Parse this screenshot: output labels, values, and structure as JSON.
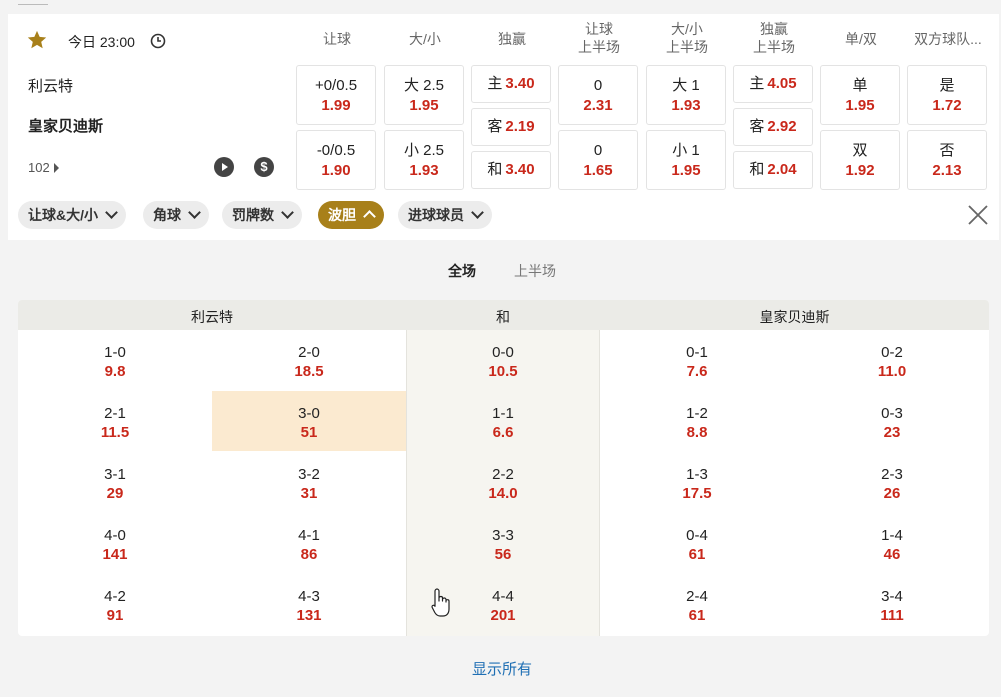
{
  "match": {
    "time": "今日 23:00",
    "home": "利云特",
    "away": "皇家贝迪斯",
    "more_count": "102",
    "dollar_symbol": "$",
    "icons": [
      "star-icon",
      "clock-icon",
      "play-icon",
      "dollar-icon",
      "close-icon"
    ]
  },
  "columns": [
    {
      "label": "让球",
      "label2": ""
    },
    {
      "label": "大/小",
      "label2": ""
    },
    {
      "label": "独赢",
      "label2": ""
    },
    {
      "label": "让球",
      "label2": "上半场"
    },
    {
      "label": "大/小",
      "label2": "上半场"
    },
    {
      "label": "独赢",
      "label2": "上半场"
    },
    {
      "label": "单/双",
      "label2": ""
    },
    {
      "label": "双方球队...",
      "label2": ""
    }
  ],
  "odds": {
    "handicap": [
      {
        "line": "+0/0.5",
        "odd": "1.99"
      },
      {
        "line": "-0/0.5",
        "odd": "1.90"
      }
    ],
    "over_under": [
      {
        "line": "大 2.5",
        "odd": "1.95"
      },
      {
        "line": "小 2.5",
        "odd": "1.93"
      }
    ],
    "moneyline": [
      {
        "line": "主",
        "odd": "3.40"
      },
      {
        "line": "客",
        "odd": "2.19"
      },
      {
        "line": "和",
        "odd": "3.40"
      }
    ],
    "handicap_half": [
      {
        "line": "0",
        "odd": "2.31"
      },
      {
        "line": "0",
        "odd": "1.65"
      }
    ],
    "over_under_half": [
      {
        "line": "大 1",
        "odd": "1.93"
      },
      {
        "line": "小 1",
        "odd": "1.95"
      }
    ],
    "moneyline_half": [
      {
        "line": "主",
        "odd": "4.05"
      },
      {
        "line": "客",
        "odd": "2.92"
      },
      {
        "line": "和",
        "odd": "2.04"
      }
    ],
    "odd_even": [
      {
        "line": "单",
        "odd": "1.95"
      },
      {
        "line": "双",
        "odd": "1.92"
      }
    ],
    "btts": [
      {
        "line": "是",
        "odd": "1.72"
      },
      {
        "line": "否",
        "odd": "2.13"
      }
    ]
  },
  "filters": [
    {
      "label": "让球&大/小",
      "active": false
    },
    {
      "label": "角球",
      "active": false
    },
    {
      "label": "罚牌数",
      "active": false
    },
    {
      "label": "波胆",
      "active": true
    },
    {
      "label": "进球球员",
      "active": false
    }
  ],
  "tabs": {
    "full": "全场",
    "half": "上半场",
    "selected": "全场"
  },
  "correct_score": {
    "headers": {
      "home": "利云特",
      "draw": "和",
      "away": "皇家贝迪斯"
    },
    "rows": [
      [
        {
          "s": "1-0",
          "o": "9.8"
        },
        {
          "s": "2-0",
          "o": "18.5"
        },
        {
          "s": "0-0",
          "o": "10.5"
        },
        {
          "s": "0-1",
          "o": "7.6"
        },
        {
          "s": "0-2",
          "o": "11.0"
        }
      ],
      [
        {
          "s": "2-1",
          "o": "11.5"
        },
        {
          "s": "3-0",
          "o": "51"
        },
        {
          "s": "1-1",
          "o": "6.6"
        },
        {
          "s": "1-2",
          "o": "8.8"
        },
        {
          "s": "0-3",
          "o": "23"
        }
      ],
      [
        {
          "s": "3-1",
          "o": "29"
        },
        {
          "s": "3-2",
          "o": "31"
        },
        {
          "s": "2-2",
          "o": "14.0"
        },
        {
          "s": "1-3",
          "o": "17.5"
        },
        {
          "s": "2-3",
          "o": "26"
        }
      ],
      [
        {
          "s": "4-0",
          "o": "141"
        },
        {
          "s": "4-1",
          "o": "86"
        },
        {
          "s": "3-3",
          "o": "56"
        },
        {
          "s": "0-4",
          "o": "61"
        },
        {
          "s": "1-4",
          "o": "46"
        }
      ],
      [
        {
          "s": "4-2",
          "o": "91"
        },
        {
          "s": "4-3",
          "o": "131"
        },
        {
          "s": "4-4",
          "o": "201"
        },
        {
          "s": "2-4",
          "o": "61"
        },
        {
          "s": "3-4",
          "o": "111"
        }
      ]
    ],
    "highlighted": "3-0"
  },
  "show_all": "显示所有",
  "colors": {
    "odds_red": "#c9281b",
    "accent_gold": "#a8801a",
    "highlight": "#fbead0",
    "link_blue": "#1f6fb4"
  }
}
